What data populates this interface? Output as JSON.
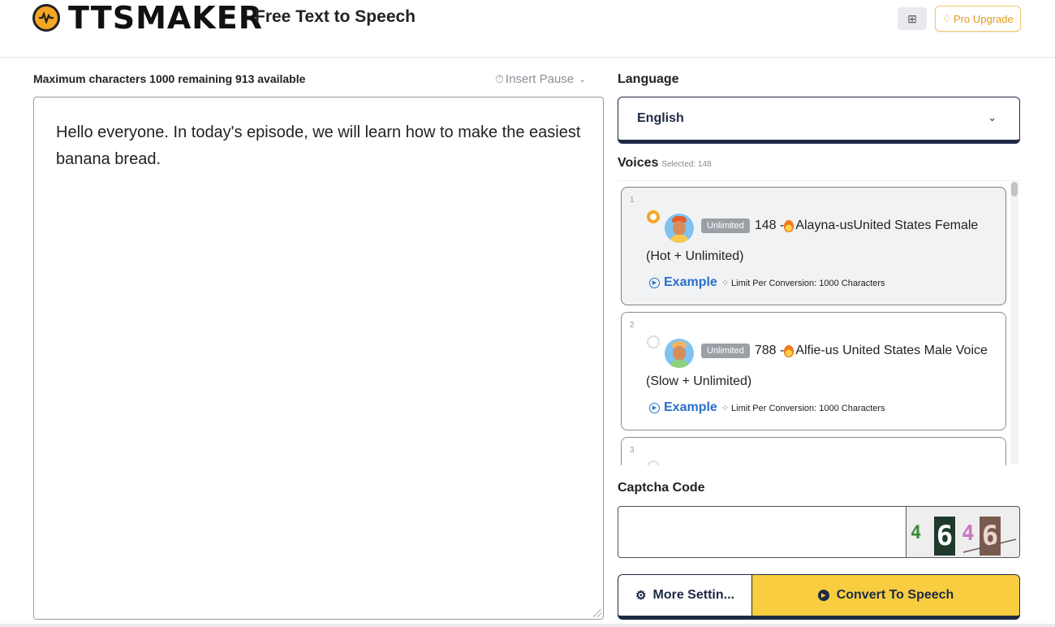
{
  "header": {
    "logo_text": "TTSMAKER",
    "tagline": "Free Text to Speech",
    "language_icon": "translate-icon",
    "pro_upgrade_label": "Pro Upgrade"
  },
  "editor": {
    "max_chars_text": "Maximum characters 1000 remaining 913 available",
    "insert_pause_label": "Insert Pause",
    "text": "Hello everyone. In today's episode, we will learn how to make the easiest banana bread."
  },
  "language": {
    "label": "Language",
    "selected": "English"
  },
  "voices": {
    "label": "Voices",
    "selected_text": "Selected: 148",
    "items": [
      {
        "number": "1",
        "badge": "Unlimited",
        "title_prefix": "148 - ",
        "title_name": "Alayna-usUnited States Female",
        "title_suffix": "(Hot + Unlimited)",
        "example_label": "Example",
        "limit_text": "Limit Per Conversion: 1000 Characters",
        "selected": true
      },
      {
        "number": "2",
        "badge": "Unlimited",
        "title_prefix": "788 - ",
        "title_name": "Alfie-us United States Male Voice",
        "title_suffix": "(Slow + Unlimited)",
        "example_label": "Example",
        "limit_text": "Limit Per Conversion: 1000 Characters",
        "selected": false
      },
      {
        "number": "3"
      }
    ]
  },
  "captcha": {
    "label": "Captcha Code",
    "input_value": "",
    "image_chars": [
      "4",
      "6",
      "4",
      "6"
    ]
  },
  "actions": {
    "more_settings_label": "More Settin...",
    "convert_label": "Convert To Speech"
  },
  "colors": {
    "accent_yellow": "#f8cd3f",
    "navy": "#1e2a44",
    "link_blue": "#2a6fc9",
    "pro_orange": "#e39a1b"
  }
}
